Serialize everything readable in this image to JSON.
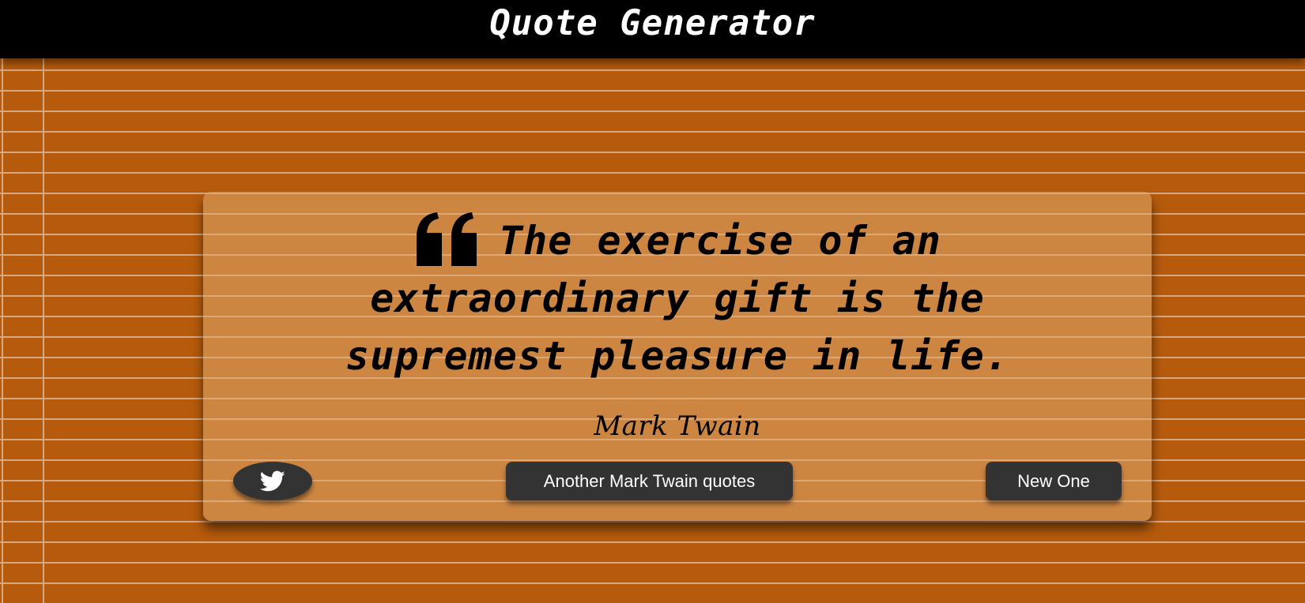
{
  "header": {
    "title": "Quote Generator"
  },
  "quote": {
    "icon": "quote-left-icon",
    "text": "The exercise of an extraordinary gift is the supremest pleasure in life.",
    "author": "Mark Twain"
  },
  "actions": {
    "tweet_icon": "twitter-icon",
    "author_quotes_label": "Another Mark Twain quotes",
    "new_quote_label": "New One"
  },
  "colors": {
    "header_bg": "#000000",
    "brick": "#b65b0d",
    "mortar": "#d8a980",
    "button_bg": "#333333",
    "button_text": "#ffffff"
  }
}
